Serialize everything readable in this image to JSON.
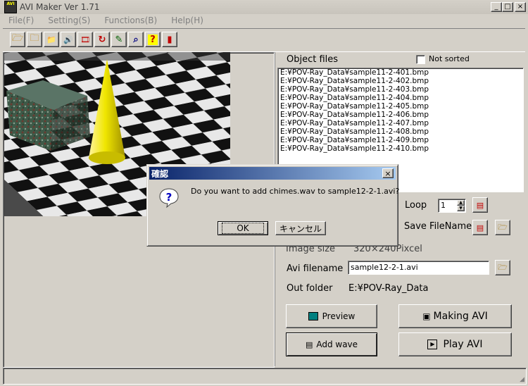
{
  "window": {
    "title": "AVI Maker Ver 1.71",
    "app_icon_text": "AVI"
  },
  "window_controls": {
    "minimize": "_",
    "maximize": "□",
    "close": "×"
  },
  "menu": [
    "File(F)",
    "Setting(S)",
    "Functions(B)",
    "Help(H)"
  ],
  "toolbar": [
    "open-folder-icon",
    "open-file-icon",
    "folder-icon",
    "speaker-icon",
    "film-icon",
    "refresh-icon",
    "edit-icon",
    "binoculars-icon",
    "help-icon",
    "exit-icon"
  ],
  "toolbar_glyphs": [
    "🗁",
    "🗀",
    "📁",
    "🔊",
    "🎞",
    "↻",
    "✎",
    "⌕",
    "?",
    "▮"
  ],
  "object_files": {
    "label": "Object files",
    "not_sorted_label": "Not sorted",
    "not_sorted_checked": false,
    "files": [
      "E:¥POV-Ray_Data¥sample11-2-401.bmp",
      "E:¥POV-Ray_Data¥sample11-2-402.bmp",
      "E:¥POV-Ray_Data¥sample11-2-403.bmp",
      "E:¥POV-Ray_Data¥sample11-2-404.bmp",
      "E:¥POV-Ray_Data¥sample11-2-405.bmp",
      "E:¥POV-Ray_Data¥sample11-2-406.bmp",
      "E:¥POV-Ray_Data¥sample11-2-407.bmp",
      "E:¥POV-Ray_Data¥sample11-2-408.bmp",
      "E:¥POV-Ray_Data¥sample11-2-409.bmp",
      "E:¥POV-Ray_Data¥sample11-2-410.bmp"
    ]
  },
  "loop": {
    "label": "Loop",
    "value": "1"
  },
  "save_filename": {
    "label": "Save FileName"
  },
  "image_size": {
    "label": "Image size",
    "value": "320×240Pixcel"
  },
  "avi_filename": {
    "label": "Avi filename",
    "value": "sample12-2-1.avi"
  },
  "out_folder": {
    "label": "Out folder",
    "value": "E:¥POV-Ray_Data"
  },
  "buttons": {
    "preview": "Preview",
    "making_avi": "Making AVI",
    "add_wave": "Add wave",
    "play_avi": "Play AVI"
  },
  "dialog": {
    "title": "確認",
    "message": "Do you want to add chimes.wav to sample12-2-1.avi?",
    "ok": "OK",
    "cancel": "キャンセル",
    "icon": "question-icon"
  },
  "colors": {
    "dialog_title_start": "#0a246a",
    "dialog_title_end": "#a6caf0",
    "cone": "#f0e600",
    "cube": "#3e5a48"
  }
}
